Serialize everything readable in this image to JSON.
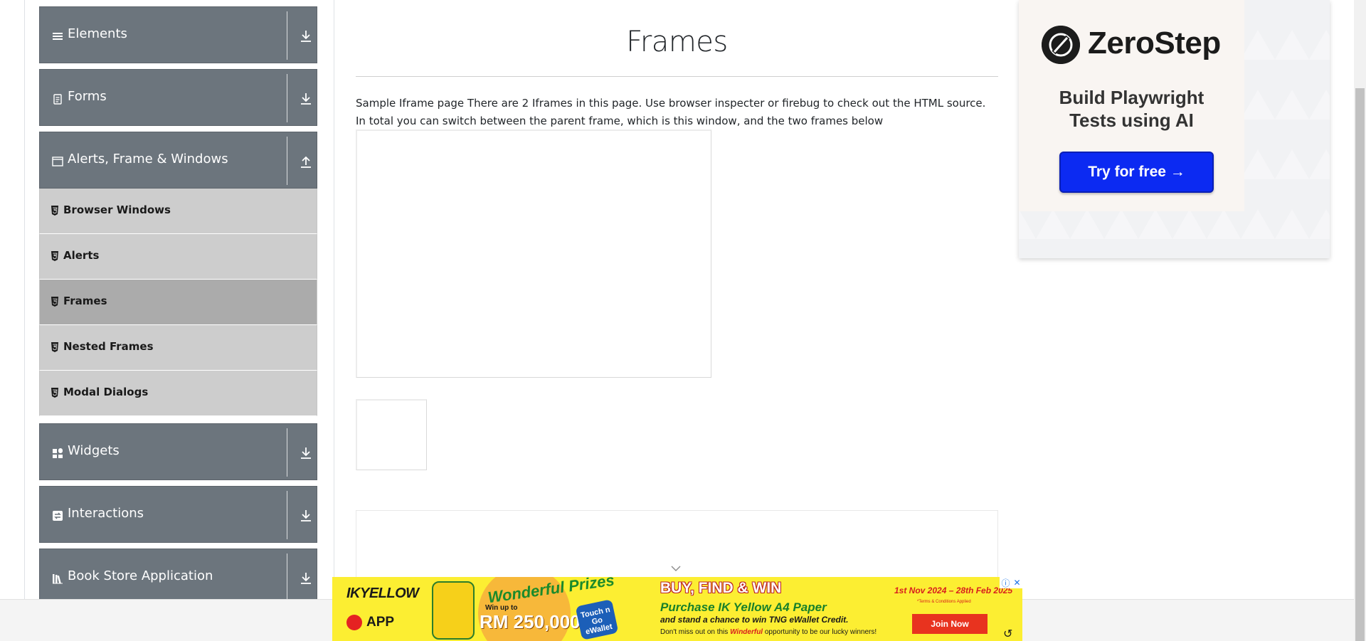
{
  "sidebar": {
    "groups": [
      {
        "label": "Elements",
        "icon": "list-icon",
        "toggle": "download-arrow-icon"
      },
      {
        "label": "Forms",
        "icon": "document-icon",
        "toggle": "download-arrow-icon"
      },
      {
        "label": "Alerts, Frame & Windows",
        "icon": "window-icon",
        "toggle": "upload-arrow-icon"
      },
      {
        "label": "Widgets",
        "icon": "widgets-grid-icon",
        "toggle": "download-arrow-icon"
      },
      {
        "label": "Interactions",
        "icon": "interaction-icon",
        "toggle": "download-arrow-icon"
      },
      {
        "label": "Book Store Application",
        "icon": "book-icon",
        "toggle": "download-arrow-icon"
      }
    ],
    "alerts_items": [
      {
        "label": "Browser Windows",
        "icon": "html5-icon"
      },
      {
        "label": "Alerts",
        "icon": "html5-icon"
      },
      {
        "label": "Frames",
        "icon": "html5-icon",
        "active": true
      },
      {
        "label": "Nested Frames",
        "icon": "html5-icon"
      },
      {
        "label": "Modal Dialogs",
        "icon": "html5-icon"
      }
    ]
  },
  "main": {
    "title": "Frames",
    "description": "Sample Iframe page There are 2 Iframes in this page. Use browser inspecter or firebug to check out the HTML source. In total you can switch between the parent frame, which is this window, and the two frames below"
  },
  "ad_right": {
    "brand": "ZeroStep",
    "headline": "Build Playwright Tests using AI",
    "cta": "Try for free →",
    "accent": "#0c2af2"
  },
  "ad_bottom": {
    "brand": "IKYELLOW",
    "app": "APP",
    "wonderful": "Wonderful Prizes",
    "win_up_to": "Win up to",
    "amount": "RM 250,000",
    "touch": "Touch n Go eWallet",
    "buy": "BUY, FIND & WIN",
    "purchase": "Purchase IK Yellow A4 Paper",
    "chance": "and stand a chance to win TNG eWallet Credit.",
    "miss_pre": "Don't miss out on this ",
    "miss_word": "Winderful",
    "miss_post": " opportunity to be our lucky winners!",
    "date": "1st Nov 2024 – 28th Feb 2025",
    "terms": "*Terms & Conditions Applied",
    "join": "Join Now",
    "bg_color": "#fcee32"
  }
}
